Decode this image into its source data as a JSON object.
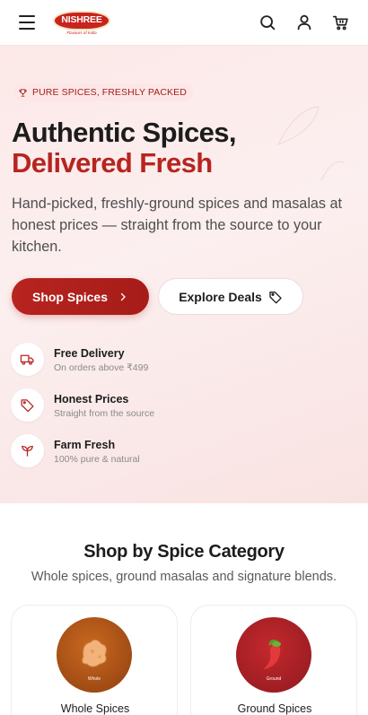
{
  "header": {
    "logo_text": "NISHREE",
    "logo_tagline": "Flavours of India"
  },
  "hero": {
    "badge": "PURE SPICES, FRESHLY PACKED",
    "headline_line1": "Authentic Spices,",
    "headline_line2": "Delivered Fresh",
    "description": "Hand-picked, freshly-ground spices and masalas at honest prices — straight from the source to your kitchen.",
    "primary_button": "Shop Spices",
    "secondary_button": "Explore Deals",
    "features": [
      {
        "title": "Free Delivery",
        "subtitle": "On orders above ₹499",
        "icon": "truck-icon"
      },
      {
        "title": "Honest Prices",
        "subtitle": "Straight from the source",
        "icon": "tag-icon"
      },
      {
        "title": "Farm Fresh",
        "subtitle": "100% pure & natural",
        "icon": "sprout-icon"
      }
    ]
  },
  "categories": {
    "title": "Shop by Spice Category",
    "subtitle": "Whole spices, ground masalas and signature blends.",
    "items": [
      {
        "name": "Whole Spices",
        "image_caption": "Whole",
        "color": "#b4561a"
      },
      {
        "name": "Ground Spices",
        "image_caption": "Ground",
        "color": "#b8222a"
      }
    ]
  },
  "colors": {
    "brand_red": "#b72520",
    "hero_bg": "#fcebea",
    "text_dark": "#1c1c1c"
  }
}
